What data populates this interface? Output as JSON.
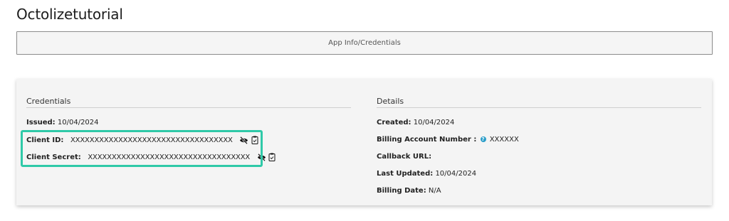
{
  "app": {
    "title": "Octolizetutorial"
  },
  "tabs": {
    "active_label": "App Info/Credentials"
  },
  "credentials": {
    "heading": "Credentials",
    "issued_label": "Issued:",
    "issued_value": "10/04/2024",
    "client_id_label": "Client ID:",
    "client_id_value": "XXXXXXXXXXXXXXXXXXXXXXXXXXXXXXXXXX",
    "client_secret_label": "Client Secret:",
    "client_secret_value": "XXXXXXXXXXXXXXXXXXXXXXXXXXXXXXXXXX",
    "icons": [
      "eye-slash-icon",
      "clipboard-icon"
    ]
  },
  "details": {
    "heading": "Details",
    "created_label": "Created:",
    "created_value": "10/04/2024",
    "billing_account_label": "Billing Account Number :",
    "billing_account_value": "XXXXXX",
    "callback_label": "Callback URL:",
    "callback_value": "",
    "last_updated_label": "Last Updated:",
    "last_updated_value": "10/04/2024",
    "billing_date_label": "Billing Date:",
    "billing_date_value": "N/A"
  },
  "colors": {
    "highlight": "#2fc9a8",
    "card_background": "#f4f4f4",
    "help_icon": "#2b9ec9"
  }
}
